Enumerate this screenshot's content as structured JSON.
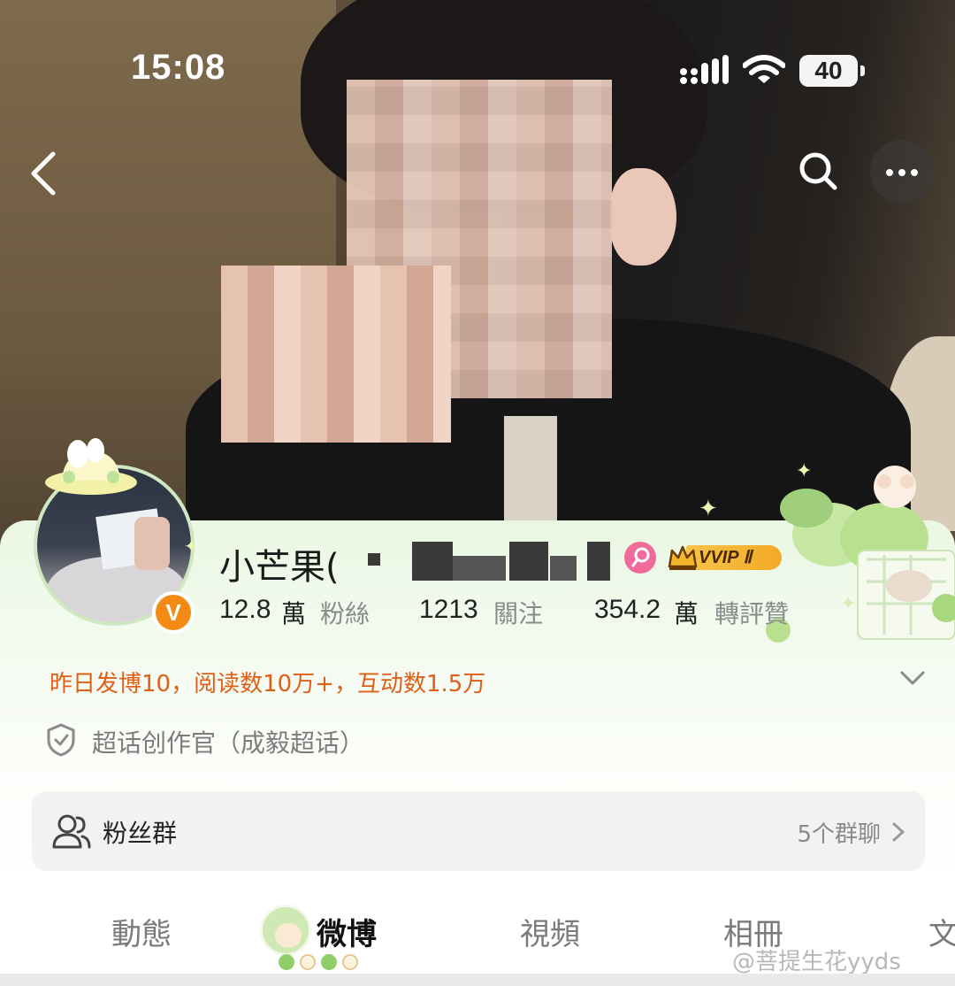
{
  "status_bar": {
    "time": "15:08",
    "battery": "40"
  },
  "profile": {
    "name_visible": "小芒果(",
    "followers_count": "12.8",
    "followers_unit": "萬",
    "followers_label": "粉絲",
    "following_count": "1213",
    "following_label": "關注",
    "likes_count": "354.2",
    "likes_unit": "萬",
    "likes_label": "轉評贊",
    "vip_badge": "VVIP Ⅱ",
    "verified_mark": "V",
    "activity_summary": "昨日发博10，阅读数10万+，互动数1.5万",
    "supertopic_role": "超话创作官（成毅超话）"
  },
  "fan_group": {
    "label": "粉丝群",
    "count": "5个群聊"
  },
  "tabs": [
    {
      "label": "動態"
    },
    {
      "label": "微博"
    },
    {
      "label": "視頻"
    },
    {
      "label": "相冊"
    },
    {
      "label": "文"
    }
  ],
  "active_tab": "微博",
  "watermark": "@菩提生花yyds",
  "colors": {
    "activity_text": "#e05f17",
    "verified_badge": "#f28a13",
    "fan_badge": "#f16a9c",
    "vip_gold": "#f2a925",
    "card_tint": "#eaf7e2"
  },
  "icons": {
    "back": "chevron-left-icon",
    "search": "search-icon",
    "more": "more-dots-icon",
    "signal": "signal-icon",
    "wifi": "wifi-icon",
    "battery": "battery-icon",
    "supertopic": "shield-icon",
    "fan_group": "people-icon",
    "expand": "chevron-down-icon",
    "go": "chevron-right-icon"
  }
}
